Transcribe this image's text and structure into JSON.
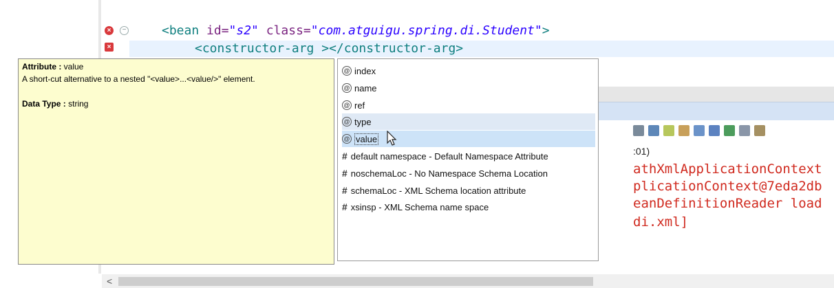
{
  "editor": {
    "line1": {
      "open": "<bean",
      "id_attr": " id=",
      "id_value": "\"s2\"",
      "class_attr": " class=",
      "class_value": "\"com.atguigu.spring.di.Student\"",
      "close": ">"
    },
    "line2": {
      "open": "<constructor-arg",
      "gap": " >",
      "close": "</constructor-arg>"
    }
  },
  "tooltip": {
    "attribute_label": "Attribute : ",
    "attribute_value": "value",
    "description": "A short-cut alternative to a nested \"<value>...<value/>\" element.",
    "datatype_label": "Data Type : ",
    "datatype_value": "string"
  },
  "assist": {
    "attributes": [
      {
        "label": "index",
        "icon": "attribute-icon"
      },
      {
        "label": "name",
        "icon": "attribute-icon"
      },
      {
        "label": "ref",
        "icon": "attribute-icon"
      },
      {
        "label": "type",
        "icon": "attribute-icon"
      },
      {
        "label": "value",
        "icon": "attribute-icon",
        "selected": true
      }
    ],
    "namespaces": [
      {
        "label": "default namespace - Default Namespace Attribute",
        "icon": "hash-icon"
      },
      {
        "label": "noschemaLoc - No Namespace Schema Location",
        "icon": "hash-icon"
      },
      {
        "label": "schemaLoc - XML Schema location attribute",
        "icon": "hash-icon"
      },
      {
        "label": "xsinsp - XML Schema name space",
        "icon": "hash-icon"
      }
    ]
  },
  "console": {
    "time_fragment": ":01)",
    "lines": [
      "athXmlApplicationContext",
      "plicationContext@7eda2db",
      "eanDefinitionReader load",
      "di.xml]"
    ]
  },
  "scroll": {
    "left_arrow": "<"
  },
  "colors": {
    "tag": "#0f7f7f",
    "attribute": "#7a2380",
    "string": "#2a00ff",
    "console_error": "#d02a1f",
    "tooltip_bg": "#fdfdcf",
    "selection": "#cde3f8"
  }
}
